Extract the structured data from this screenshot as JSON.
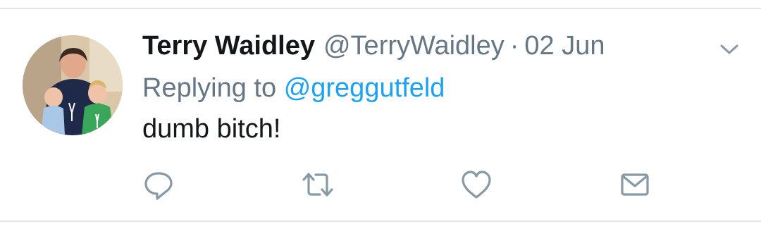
{
  "tweet": {
    "author_name": "Terry Waidley",
    "author_handle": "@TerryWaidley",
    "separator": "·",
    "date": "02 Jun",
    "replying_prefix": "Replying to",
    "replying_handle": "@greggutfeld",
    "text": "dumb bitch!"
  },
  "icons": {
    "caret": "chevron-down-icon",
    "reply": "reply-icon",
    "retweet": "retweet-icon",
    "like": "heart-icon",
    "dm": "envelope-icon"
  },
  "colors": {
    "name": "#14171a",
    "secondary": "#657786",
    "mention": "#1da1f2",
    "divider": "#dfe4e8",
    "icon": "#8899a6"
  }
}
